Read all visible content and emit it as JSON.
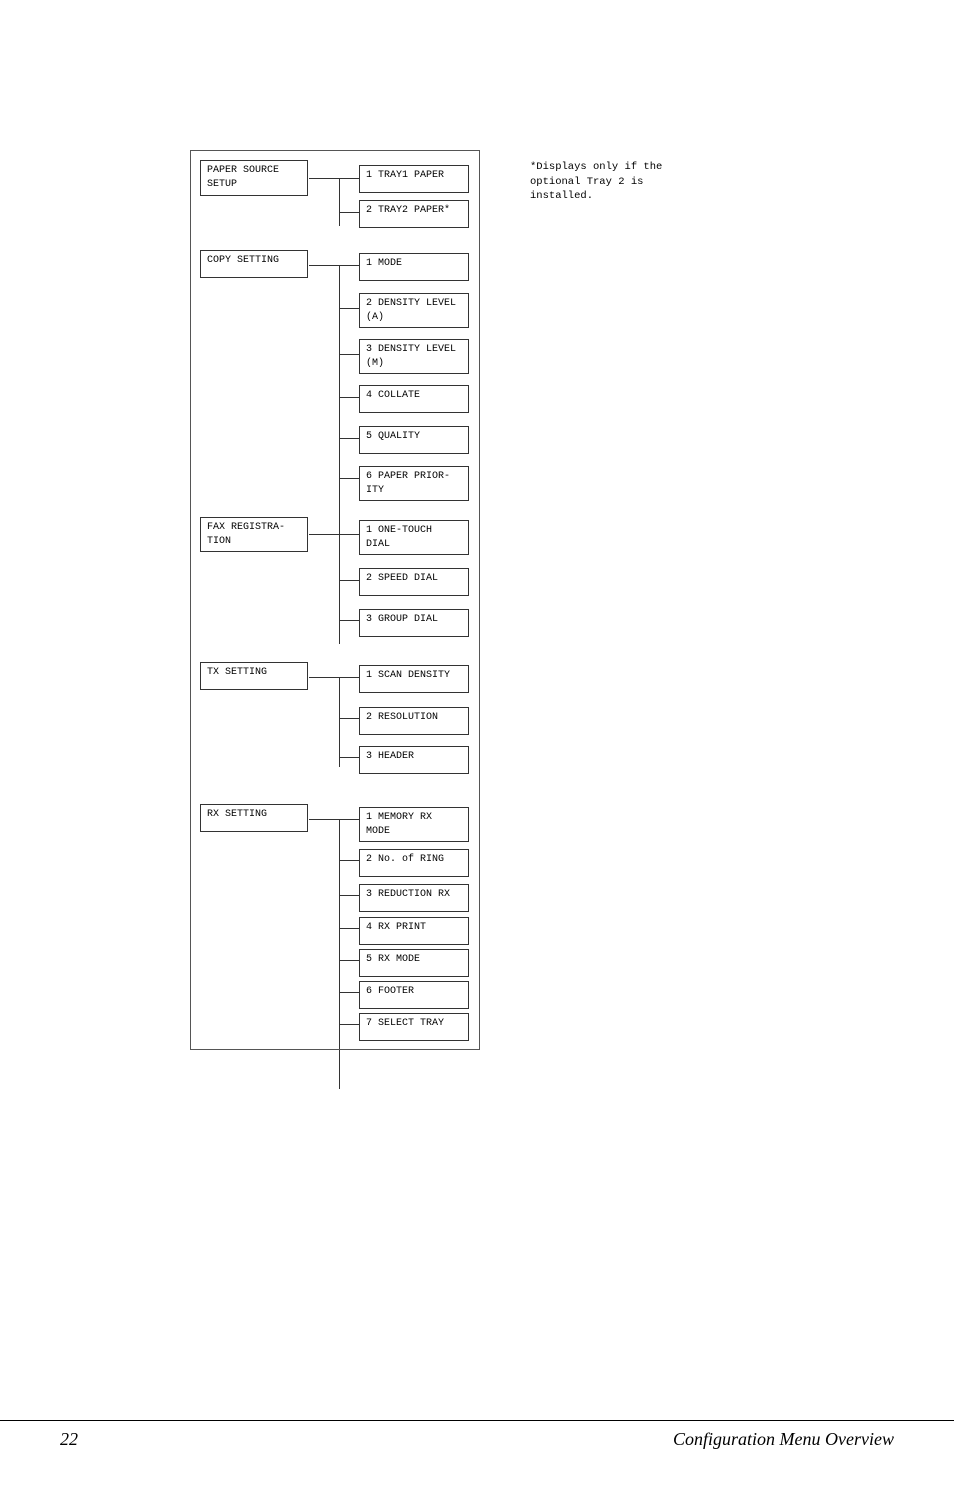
{
  "page": {
    "number": "22",
    "title": "Configuration Menu Overview"
  },
  "note": {
    "text": "*Displays only if the optional Tray 2 is installed."
  },
  "sections": {
    "paper_source_setup": {
      "label": "PAPER SOURCE\nSETUP",
      "items": [
        {
          "label": "1 TRAY1 PAPER"
        },
        {
          "label": "2 TRAY2 PAPER*"
        }
      ]
    },
    "copy_setting": {
      "label": "COPY SETTING",
      "items": [
        {
          "label": "1 MODE"
        },
        {
          "label": "2 DENSITY LEVEL\n(A)"
        },
        {
          "label": "3 DENSITY LEVEL\n(M)"
        },
        {
          "label": "4 COLLATE"
        },
        {
          "label": "5 QUALITY"
        },
        {
          "label": "6 PAPER PRIOR-\nITY"
        }
      ]
    },
    "fax_registration": {
      "label": "FAX REGISTRA-\nTION",
      "items": [
        {
          "label": "1 ONE-TOUCH\nDIAL"
        },
        {
          "label": "2 SPEED DIAL"
        },
        {
          "label": "3 GROUP DIAL"
        }
      ]
    },
    "tx_setting": {
      "label": "TX SETTING",
      "items": [
        {
          "label": "1 SCAN DENSITY"
        },
        {
          "label": "2 RESOLUTION"
        },
        {
          "label": "3 HEADER"
        }
      ]
    },
    "rx_setting": {
      "label": "RX SETTING",
      "items": [
        {
          "label": "1 MEMORY RX\nMODE"
        },
        {
          "label": "2 No. of RING"
        },
        {
          "label": "3 REDUCTION RX"
        },
        {
          "label": "4 RX PRINT"
        },
        {
          "label": "5 RX MODE"
        },
        {
          "label": "6 FOOTER"
        },
        {
          "label": "7 SELECT TRAY"
        }
      ]
    }
  }
}
